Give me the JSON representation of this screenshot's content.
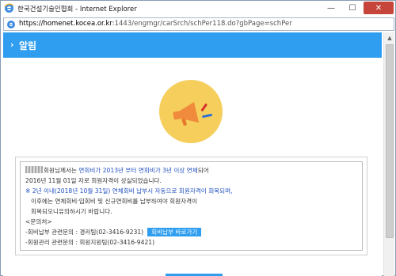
{
  "window": {
    "title": "한국건설기술인협회 - Internet Explorer",
    "buttons": {
      "minimize": "—",
      "maximize": "☐",
      "close": "✕"
    }
  },
  "address": {
    "url_host": "https://homenet.kocea.or.kr",
    "url_rest": ":1443/engmgr/carSrch/schPer118.do?gbPage=schPer"
  },
  "popup": {
    "title": "알림",
    "chevron": "›"
  },
  "notice": {
    "line1_suffix": "회원님께서는 ",
    "line1_blue": "연회비가 2013년 부터 연회비가 3년 이상 연체",
    "line1_end": "되어",
    "line2": "2016년 11월 01일 자로 회원자격이 상실되었습니다.",
    "line3": "※ 2년 이내(2018년 10월 31일) 연체회비 납부시 자동으로 회원자격이 회복되며,",
    "line4": "이후에는 연체회비·입회비 및 신규연회비를 납부하여야 회원자격이",
    "line5": "회복되오니유의하시기 바랍니다.",
    "line6": "<문의처>",
    "line7": "-회비납부 관련문의 : 경리팀(02-3416-9231)",
    "shortcut_button": "회비납부 바로가기",
    "line8": "-회원관리 관련문의 : 회원지원팀(02-3416-9421)"
  },
  "colors": {
    "accent": "#2f9ef0",
    "megaphone_bg": "#f5ce5b",
    "megaphone_body": "#f08a3c",
    "link_blue": "#1f4fbf"
  },
  "icons": {
    "app": "ie-icon",
    "address": "ie-page-icon",
    "notice": "megaphone-icon"
  }
}
